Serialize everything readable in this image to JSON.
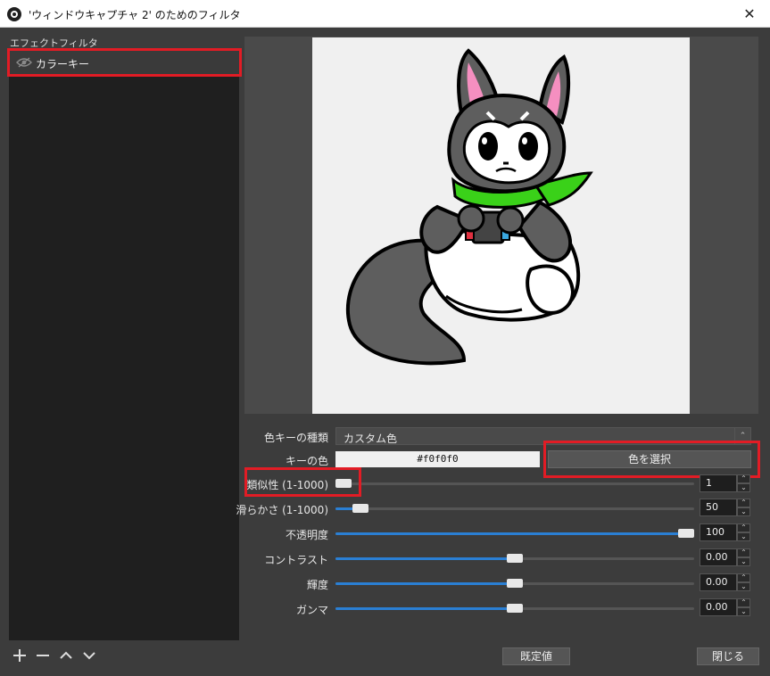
{
  "window": {
    "title": "'ウィンドウキャプチャ 2' のためのフィルタ",
    "close": "✕"
  },
  "filters": {
    "section_label": "エフェクトフィルタ",
    "items": [
      {
        "label": "カラーキー"
      }
    ],
    "buttons": {
      "add": "+",
      "remove": "−",
      "up": "∧",
      "down": "∨"
    }
  },
  "properties": {
    "key_type_label": "色キーの種類",
    "key_type_value": "カスタム色",
    "key_color_label": "キーの色",
    "key_color_value": "#f0f0f0",
    "select_color_button": "色を選択",
    "similarity_label": "類似性 (1-1000)",
    "similarity_value": "1",
    "smoothness_label": "滑らかさ (1-1000)",
    "smoothness_value": "50",
    "opacity_label": "不透明度",
    "opacity_value": "100",
    "contrast_label": "コントラスト",
    "contrast_value": "0.00",
    "brightness_label": "輝度",
    "brightness_value": "0.00",
    "gamma_label": "ガンマ",
    "gamma_value": "0.00"
  },
  "slider_levels": {
    "similarity": 0.001,
    "smoothness": 0.05,
    "opacity": 1.0,
    "contrast": 0.5,
    "brightness": 0.5,
    "gamma": 0.5
  },
  "footer": {
    "defaults_button": "既定値",
    "close_button": "閉じる"
  },
  "colors": {
    "accent": "#2a7fd4",
    "highlight": "#e21c25",
    "key_color": "#f0f0f0",
    "scarf_green": "#3ad119",
    "ear_pink": "#f58fc0"
  }
}
